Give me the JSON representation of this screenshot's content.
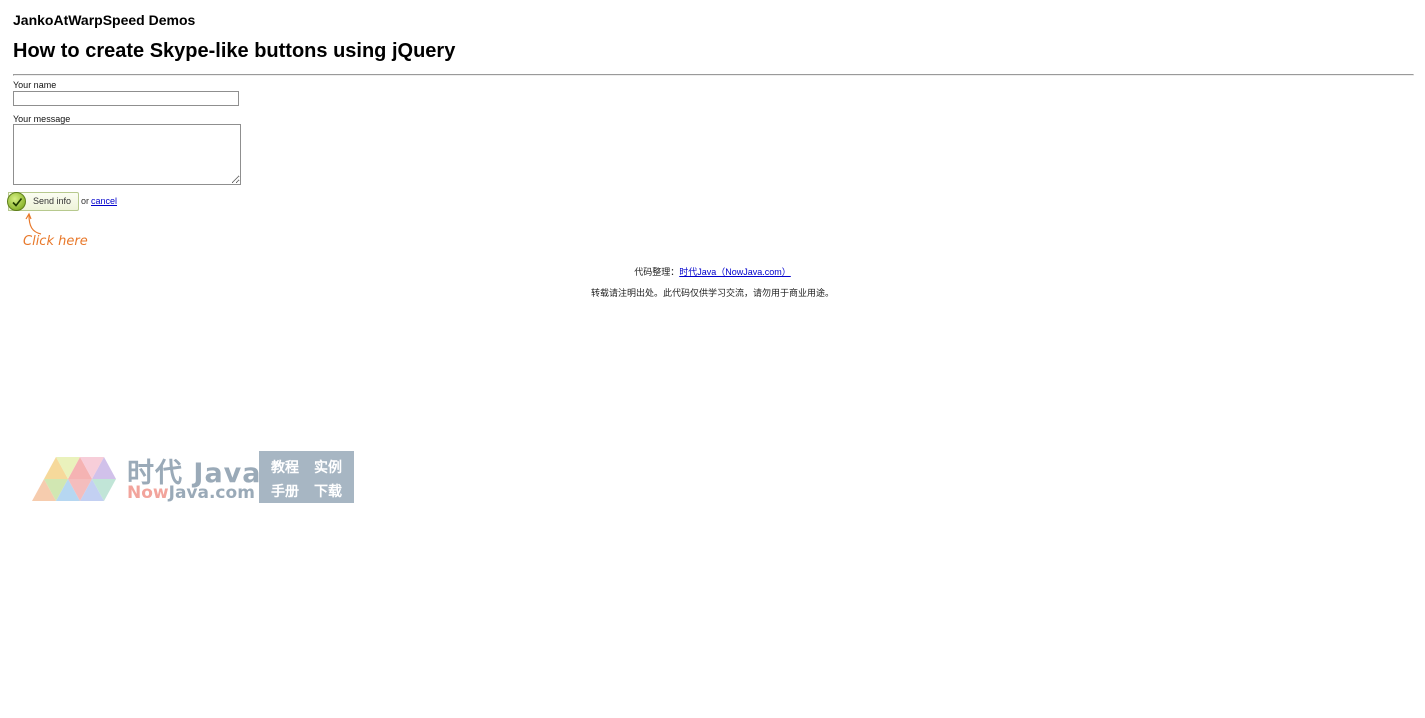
{
  "header": {
    "site_title": "JankoAtWarpSpeed Demos",
    "page_title": "How to create Skype-like buttons using jQuery"
  },
  "form": {
    "name_label": "Your name",
    "name_value": "",
    "message_label": "Your message",
    "message_value": "",
    "send_label": "Send info",
    "or_text": "or",
    "cancel_label": "cancel",
    "hint": "Click here"
  },
  "footer": {
    "credit_prefix": "代码整理：",
    "credit_link": "时代Java（NowJava.com）",
    "notice": "转载请注明出处。此代码仅供学习交流，请勿用于商业用途。"
  },
  "watermark": {
    "brand": "时代 Java",
    "domain_now": "Now",
    "domain_rest": "Java.com",
    "menu": [
      "教程",
      "实例",
      "手册",
      "下载"
    ]
  },
  "colors": {
    "hint": "#e8782a",
    "link": "#0000cc",
    "button_check": "#8fb832"
  }
}
